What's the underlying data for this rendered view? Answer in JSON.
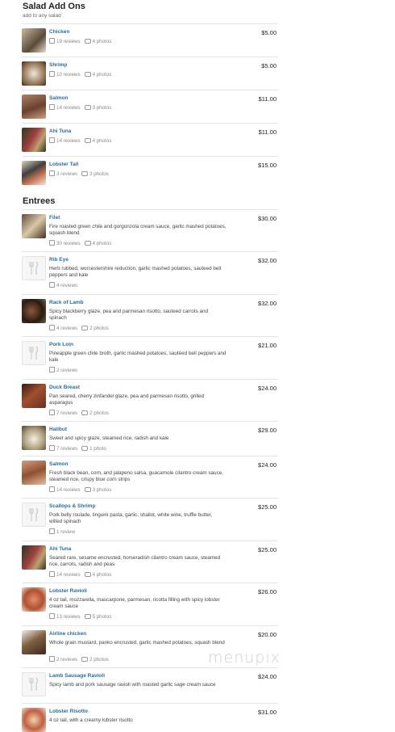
{
  "salad_section": {
    "title": "Salad Add Ons",
    "subtitle": "add to any salad"
  },
  "entrees_section": {
    "title": "Entrees"
  },
  "salad_items": [
    {
      "name": "Chicken",
      "price": "$5.00",
      "reviews": "19 reviews",
      "photos": "4 photos"
    },
    {
      "name": "Shrimp",
      "price": "$5.00",
      "reviews": "10 reviews",
      "photos": "4 photos"
    },
    {
      "name": "Salmon",
      "price": "$11.00",
      "reviews": "14 reviews",
      "photos": "3 photos"
    },
    {
      "name": "Ahi Tuna",
      "price": "$11.00",
      "reviews": "14 reviews",
      "photos": "4 photos"
    },
    {
      "name": "Lobster Tail",
      "price": "$15.00",
      "reviews": "3 reviews",
      "photos": "3 photos"
    }
  ],
  "entrees": [
    {
      "name": "Filet",
      "price": "$30.00",
      "desc": "Fire roasted green chile and gorgonzola cream sauce, garlic mashed potatoes, squash blend",
      "reviews": "30 reviews",
      "photos": "4 photos"
    },
    {
      "name": "Rib Eye",
      "price": "$32.00",
      "desc": "Herb rubbed, worcestershire reduction, garlic mashed potatoes, sauteed bell peppers and kale",
      "reviews": "4 reviews",
      "photos": ""
    },
    {
      "name": "Rack of Lamb",
      "price": "$32.00",
      "desc": "Spicy blackberry glaze, pea and parmesan risotto, sauteed carrots and spinach",
      "reviews": "4 reviews",
      "photos": "2 photos"
    },
    {
      "name": "Pork Loin",
      "price": "$21.00",
      "desc": "Pineapple green chile broth, garlic mashed potatoes, sautéed bell peppers and kale",
      "reviews": "2 reviews",
      "photos": ""
    },
    {
      "name": "Duck Breast",
      "price": "$24.00",
      "desc": "Pan seared, cherry zinfandel glaze, pea and parmesan risotto, grilled asparagus",
      "reviews": "7 reviews",
      "photos": "2 photos"
    },
    {
      "name": "Halibut",
      "price": "$29.00",
      "desc": "Sweet and spicy glaze, steamed rice, radish and kale",
      "reviews": "7 reviews",
      "photos": "1 photo"
    },
    {
      "name": "Salmon",
      "price": "$24.00",
      "desc": "Fresh black bean, corn, and jalapeno salsa, guacamole cilantro cream sauce, steamed rice, crispy blue corn strips",
      "reviews": "14 reviews",
      "photos": "3 photos"
    },
    {
      "name": "Scallops & Shrimp",
      "price": "$25.00",
      "desc": "Pork belly roulade, linguini pasta, garlic, shallot, white wine, truffle butter, wilted spinach",
      "reviews": "1 review",
      "photos": ""
    },
    {
      "name": "Ahi Tuna",
      "price": "$25.00",
      "desc": "Seared rare, sesame encrusted, horseradish cilantro cream sauce, steamed rice, carrots, radish and peas",
      "reviews": "14 reviews",
      "photos": "4 photos"
    },
    {
      "name": "Lobster Ravioli",
      "price": "$26.00",
      "desc": "4 oz tail, mozzarella, mascarpone, parmesan, ricotta filling with spicy lobster cream sauce",
      "reviews": "13 reviews",
      "photos": "5 photos"
    },
    {
      "name": "Airline chicken",
      "price": "$20.00",
      "desc": "Whole grain mustard, panko encrusted, garlic mashed potatoes, squash blend",
      "reviews": "2 reviews",
      "photos": "2 photos"
    },
    {
      "name": "Lamb Sausage Ravioli",
      "price": "$24.00",
      "desc": "Spicy lamb and pork sausage ravioli with roasted garlic sage cream sauce",
      "reviews": "",
      "photos": ""
    },
    {
      "name": "Lobster Risotto",
      "price": "$31.00",
      "desc": "4 oz tail, with a creamy lobster risotto",
      "reviews": "",
      "photos": ""
    }
  ],
  "watermark": "menupix",
  "colors": {
    "item_name": "#2a6d9a",
    "divider": "#e3e3e3"
  },
  "icons": {
    "review": "review-icon",
    "photo": "camera-icon",
    "placeholder": "fork-knife-icon"
  }
}
